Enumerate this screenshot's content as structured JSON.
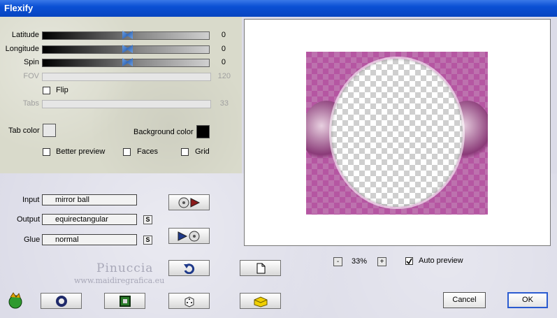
{
  "window": {
    "title": "Flexify"
  },
  "sliders": [
    {
      "label": "Latitude",
      "value": "0",
      "enabled": true
    },
    {
      "label": "Longitude",
      "value": "0",
      "enabled": true
    },
    {
      "label": "Spin",
      "value": "0",
      "enabled": true
    },
    {
      "label": "FOV",
      "value": "120",
      "enabled": false
    },
    {
      "label": "Tabs",
      "value": "33",
      "enabled": false
    }
  ],
  "flip": {
    "label": "Flip",
    "checked": false
  },
  "colors": {
    "tab_label": "Tab color",
    "tab_color": "#e8e8e8",
    "background_label": "Background color",
    "background_color": "#000000"
  },
  "options": {
    "better_preview": "Better preview",
    "faces": "Faces",
    "grid": "Grid"
  },
  "io": {
    "input_label": "Input",
    "input_value": "mirror ball",
    "output_label": "Output",
    "output_value": "equirectangular",
    "glue_label": "Glue",
    "glue_value": "normal",
    "s_label": "S"
  },
  "watermark": {
    "line1": "Pinuccia",
    "line2": "www.maidiregrafica.eu"
  },
  "zoom": {
    "minus": "-",
    "value": "33%",
    "plus": "+"
  },
  "auto_preview": {
    "label": "Auto preview",
    "checked": true
  },
  "buttons": {
    "cancel": "Cancel",
    "ok": "OK"
  }
}
